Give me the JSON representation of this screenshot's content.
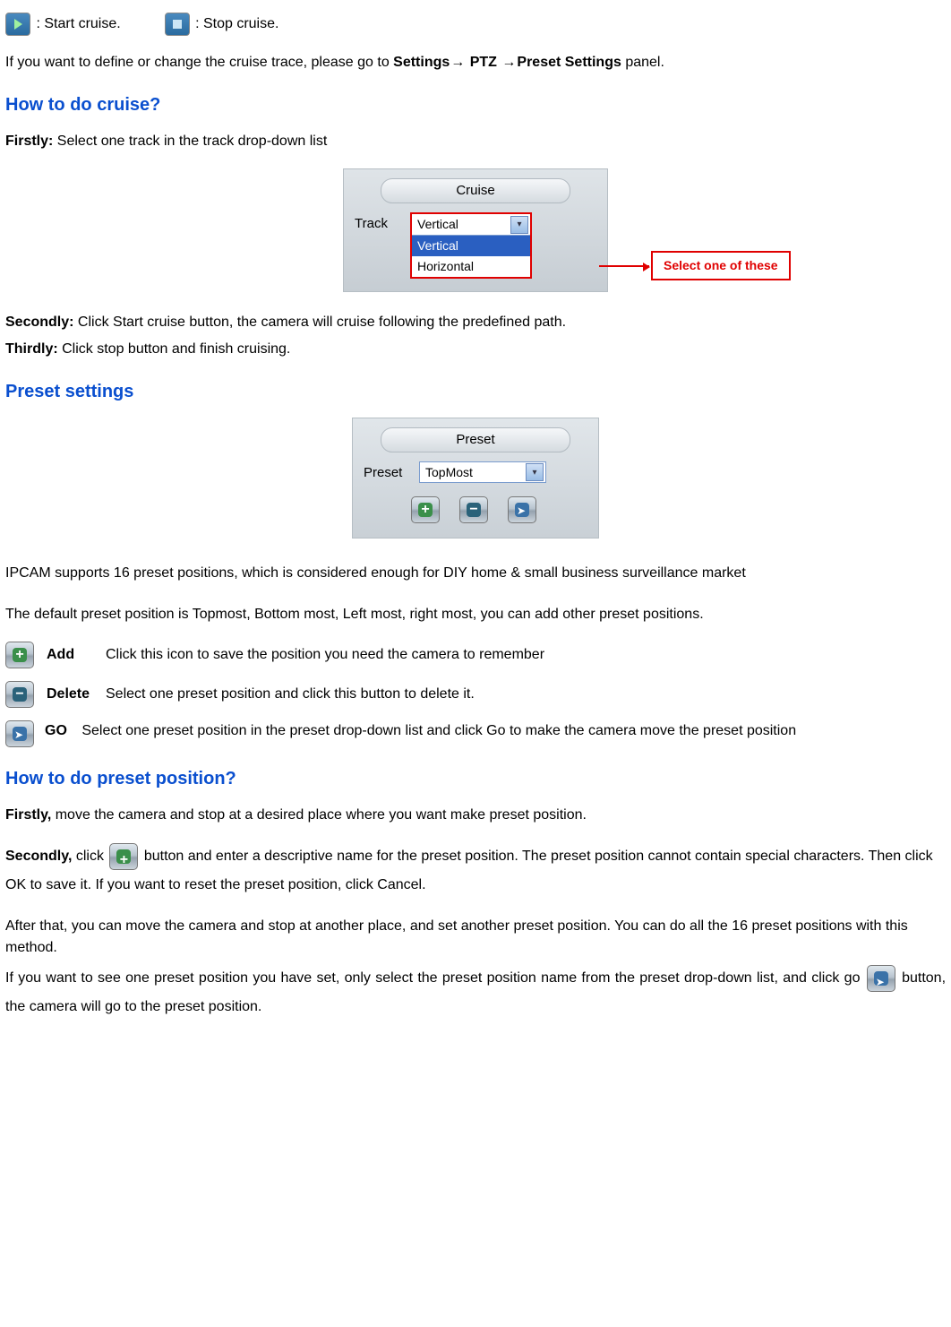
{
  "top": {
    "start_label": ": Start cruise.",
    "stop_label": ": Stop cruise.",
    "define_text_pre": "If you want to define or change the cruise trace, please go to ",
    "settings": "Settings",
    "ptz": " PTZ ",
    "preset_settings": "Preset Settings",
    "define_text_post": " panel."
  },
  "h1": "How to do cruise?",
  "firstly_lbl": "Firstly:",
  "firstly_txt": " Select one track in the track drop-down list",
  "cruise_panel": {
    "title": "Cruise",
    "track_label": "Track",
    "selected": "Vertical",
    "opt1": "Vertical",
    "opt2": "Horizontal",
    "callout": "Select one of these"
  },
  "secondly_lbl": "Secondly:",
  "secondly_txt": " Click Start cruise button, the camera will cruise following the predefined path.",
  "thirdly_lbl": "Thirdly:",
  "thirdly_txt": " Click stop button and finish cruising.",
  "h2": "Preset settings",
  "preset_panel": {
    "title": "Preset",
    "label": "Preset",
    "selected": "TopMost"
  },
  "preset_intro1": "IPCAM supports 16 preset positions, which is considered enough for DIY home & small business surveillance market",
  "preset_intro2": "The default preset position is Topmost, Bottom most, Left most, right most, you can add other preset positions.",
  "add_lbl": "Add",
  "add_txt": "Click this icon to save the position you need the camera to remember",
  "del_lbl": "Delete",
  "del_txt": "Select one preset position and click this button to delete it.",
  "go_lbl": "GO",
  "go_txt": "Select one preset position in the preset drop-down list and click Go to make the camera move the preset position",
  "h3": "How to do preset position?",
  "pp_first_lbl": "Firstly,",
  "pp_first_txt": " move the camera and stop at a desired place where you want make preset position.",
  "pp_second_lbl": "Secondly,",
  "pp_second_pre": " click ",
  "pp_second_mid": " button and enter a descriptive name for the preset position. The preset position cannot contain special characters. Then click OK to save it. If you want to reset the preset position, click Cancel.",
  "pp_after": "After that, you can move the camera and stop at another place, and set another preset position. You can do all the 16 preset positions with this method.",
  "pp_see_pre": "If you want to see one preset position you have set, only select the preset position name from the preset drop-down list, and click go ",
  "pp_see_post": " button, the camera will go to the preset position."
}
